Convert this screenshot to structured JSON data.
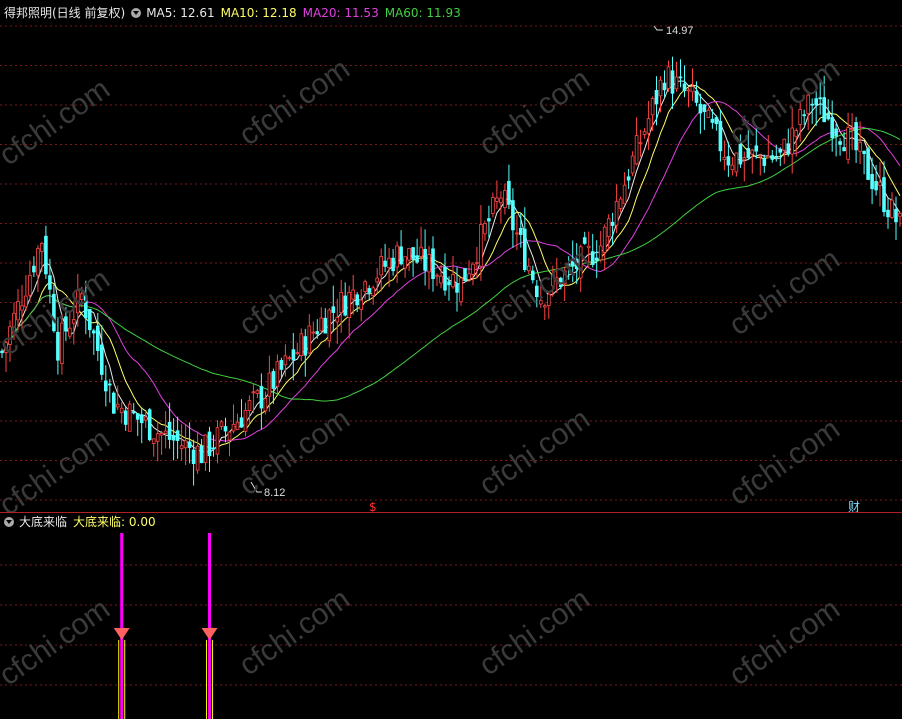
{
  "colors": {
    "background": "#000000",
    "grid": "#7a1a1a",
    "up": "#ff4444",
    "down": "#54ffff",
    "ma5": "#e8e8e8",
    "ma10": "#ffff66",
    "ma20": "#e040e0",
    "ma60": "#40d040",
    "signal": "#ff00ff",
    "signal_base": "#ffff00",
    "signal_marker": "#ff6060"
  },
  "main_panel": {
    "title": "得邦照明(日线 前复权)",
    "ma_labels": [
      {
        "label": "MA5: 12.61",
        "color": "#e8e8e8"
      },
      {
        "label": "MA10: 12.18",
        "color": "#ffff66"
      },
      {
        "label": "MA20: 11.53",
        "color": "#e040e0"
      },
      {
        "label": "MA60: 11.93",
        "color": "#40d040"
      }
    ],
    "high_label": "14.97",
    "low_label": "8.12",
    "event_marks": [
      {
        "text": "$",
        "color": "#ff3030"
      },
      {
        "text": "财",
        "color": "#7fd7ff"
      }
    ]
  },
  "indicator_panel": {
    "title": "大底来临",
    "value_label": "大底来临: 0.00"
  },
  "watermark": "cfchi.com",
  "chart_data": {
    "type": "candlestick",
    "ylim": [
      7.8,
      15.6
    ],
    "series": [
      {
        "name": "MA5"
      },
      {
        "name": "MA10"
      },
      {
        "name": "MA20"
      },
      {
        "name": "MA60"
      }
    ],
    "key_points": [
      {
        "bar": 0,
        "close": 10.3
      },
      {
        "bar": 10,
        "close": 12.1
      },
      {
        "bar": 14,
        "close": 10.4
      },
      {
        "bar": 20,
        "close": 11.2
      },
      {
        "bar": 28,
        "close": 9.5
      },
      {
        "bar": 40,
        "close": 9.0
      },
      {
        "bar": 50,
        "close": 8.7
      },
      {
        "bar": 65,
        "close": 9.6
      },
      {
        "bar": 80,
        "close": 10.8
      },
      {
        "bar": 100,
        "close": 11.9
      },
      {
        "bar": 115,
        "close": 11.4
      },
      {
        "bar": 125,
        "close": 12.8
      },
      {
        "bar": 135,
        "close": 11.2
      },
      {
        "bar": 150,
        "close": 12.0
      },
      {
        "bar": 162,
        "close": 14.0
      },
      {
        "bar": 166,
        "close": 14.7
      },
      {
        "bar": 173,
        "close": 14.3
      },
      {
        "bar": 182,
        "close": 13.4
      },
      {
        "bar": 195,
        "close": 13.4
      },
      {
        "bar": 203,
        "close": 14.3
      },
      {
        "bar": 213,
        "close": 13.6
      },
      {
        "bar": 225,
        "close": 12.3
      }
    ],
    "indicator": {
      "name": "大底来临",
      "signal_bars": [
        30,
        52
      ],
      "value": 0.0
    }
  }
}
